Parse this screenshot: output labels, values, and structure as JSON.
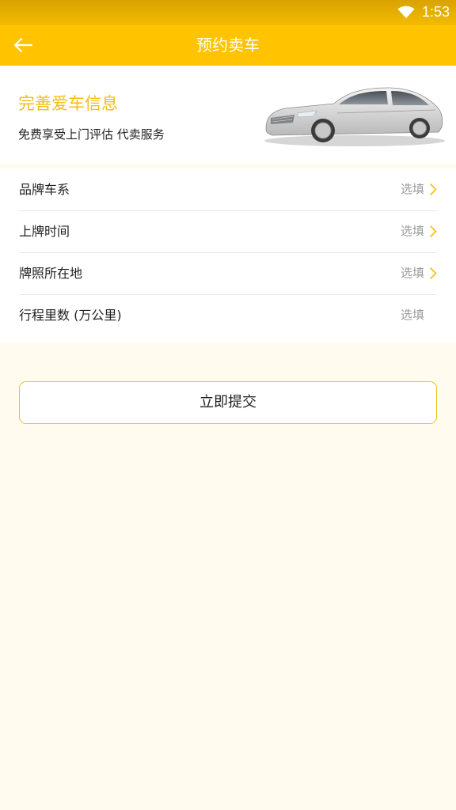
{
  "status_bar": {
    "time": "1:53",
    "wifi_icon": "wifi-icon"
  },
  "header": {
    "back_icon": "arrow-left-icon",
    "title": "预约卖车"
  },
  "banner": {
    "title": "完善爱车信息",
    "subtitle": "免费享受上门评估 代卖服务",
    "image": "car-image"
  },
  "form": {
    "rows": [
      {
        "label": "品牌车系",
        "value": "选填",
        "chevron": true
      },
      {
        "label": "上牌时间",
        "value": "选填",
        "chevron": true
      },
      {
        "label": "牌照所在地",
        "value": "选填",
        "chevron": true
      },
      {
        "label": "行程里数 (万公里)",
        "value": "选填",
        "chevron": false
      }
    ]
  },
  "submit": {
    "label": "立即提交"
  },
  "colors": {
    "primary": "#ffc300",
    "accent_text": "#f6bd16",
    "background": "#fffbee",
    "chevron": "#f6c21d"
  }
}
